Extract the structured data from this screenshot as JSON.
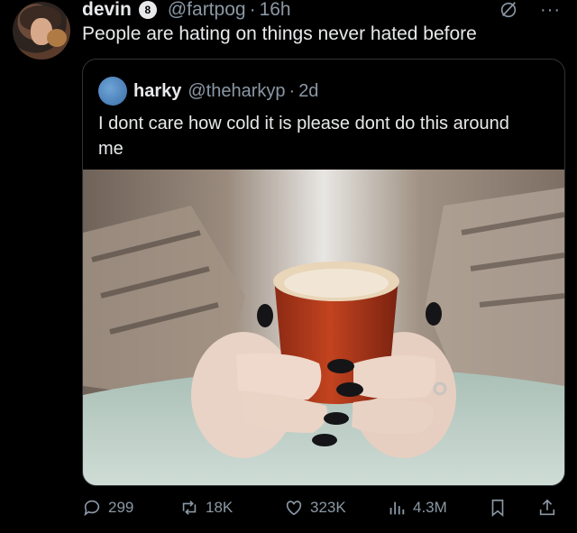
{
  "tweet": {
    "author_name": "devin",
    "badge_label": "8",
    "handle": "@fartpog",
    "separator": "·",
    "time": "16h",
    "text": "People are hating on things never hated before"
  },
  "quoted": {
    "author_name": "harky",
    "handle": "@theharkyp",
    "separator": "·",
    "time": "2d",
    "text": "I dont care how cold it is please dont do this around me"
  },
  "top_icons": [
    "grok-icon",
    "more-icon"
  ],
  "actions": {
    "replies": "299",
    "reposts": "18K",
    "likes": "323K",
    "views": "4.3M"
  },
  "colors": {
    "background": "#000000",
    "text": "#e7e9ea",
    "muted": "#8b98a5",
    "border": "#2f3336",
    "cup": "#b63a1e"
  }
}
